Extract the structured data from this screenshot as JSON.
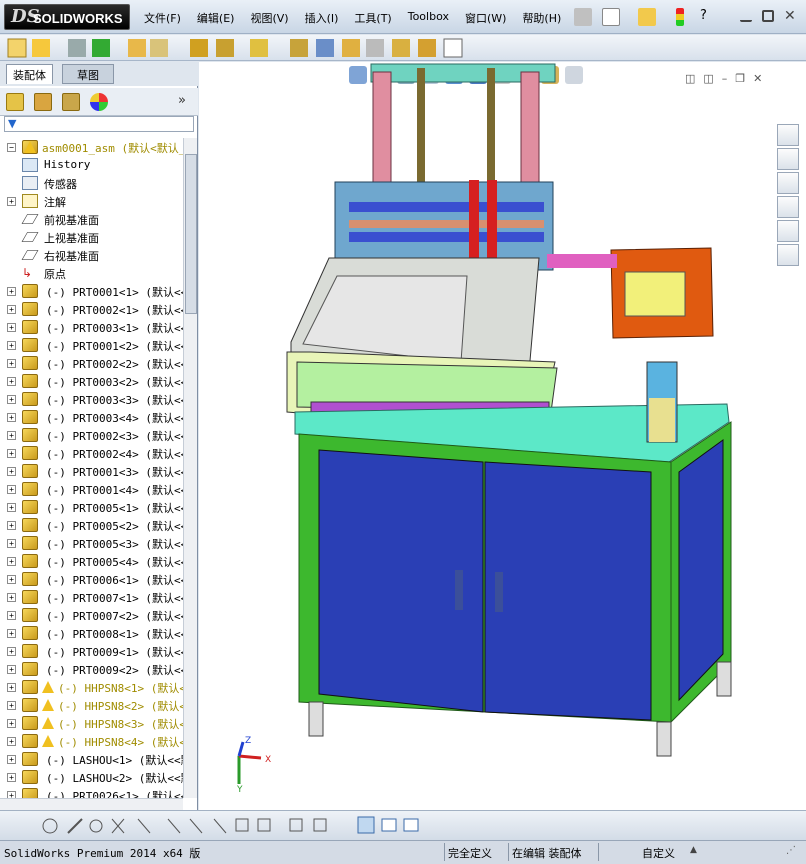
{
  "app": {
    "logo_prefix": "DS",
    "logo_name": "SOLIDWORKS"
  },
  "menu": [
    "文件(F)",
    "编辑(E)",
    "视图(V)",
    "插入(I)",
    "工具(T)",
    "Toolbox",
    "窗口(W)",
    "帮助(H)"
  ],
  "tabs": {
    "assembly": "装配体",
    "sketch": "草图"
  },
  "tree": [
    {
      "label": "asm0001_asm  (默认<默认_",
      "kind": "root"
    },
    {
      "label": "History",
      "kind": "history"
    },
    {
      "label": "传感器",
      "kind": "sensor"
    },
    {
      "label": "注解",
      "kind": "annotation"
    },
    {
      "label": "前视基准面",
      "kind": "plane"
    },
    {
      "label": "上视基准面",
      "kind": "plane"
    },
    {
      "label": "右视基准面",
      "kind": "plane"
    },
    {
      "label": "原点",
      "kind": "origin"
    },
    {
      "label": "(-) PRT0001<1> (默认<<默",
      "kind": "part"
    },
    {
      "label": "(-) PRT0002<1> (默认<<默",
      "kind": "part"
    },
    {
      "label": "(-) PRT0003<1> (默认<<默",
      "kind": "part"
    },
    {
      "label": "(-) PRT0001<2> (默认<<默",
      "kind": "part"
    },
    {
      "label": "(-) PRT0002<2> (默认<<默",
      "kind": "part"
    },
    {
      "label": "(-) PRT0003<2> (默认<<默",
      "kind": "part"
    },
    {
      "label": "(-) PRT0003<3> (默认<<默",
      "kind": "part"
    },
    {
      "label": "(-) PRT0003<4> (默认<<默",
      "kind": "part"
    },
    {
      "label": "(-) PRT0002<3> (默认<<默",
      "kind": "part"
    },
    {
      "label": "(-) PRT0002<4> (默认<<默",
      "kind": "part"
    },
    {
      "label": "(-) PRT0001<3> (默认<<默",
      "kind": "part"
    },
    {
      "label": "(-) PRT0001<4> (默认<<默",
      "kind": "part"
    },
    {
      "label": "(-) PRT0005<1> (默认<<默",
      "kind": "part"
    },
    {
      "label": "(-) PRT0005<2> (默认<<默",
      "kind": "part"
    },
    {
      "label": "(-) PRT0005<3> (默认<<默",
      "kind": "part"
    },
    {
      "label": "(-) PRT0005<4> (默认<<默",
      "kind": "part"
    },
    {
      "label": "(-) PRT0006<1> (默认<<默",
      "kind": "part"
    },
    {
      "label": "(-) PRT0007<1> (默认<<默",
      "kind": "part"
    },
    {
      "label": "(-) PRT0007<2> (默认<<默",
      "kind": "part"
    },
    {
      "label": "(-) PRT0008<1> (默认<<默",
      "kind": "part"
    },
    {
      "label": "(-) PRT0009<1> (默认<<默",
      "kind": "part"
    },
    {
      "label": "(-) PRT0009<2> (默认<<默",
      "kind": "part"
    },
    {
      "label": "(-) HHPSN8<1> (默认<",
      "kind": "warn"
    },
    {
      "label": "(-) HHPSN8<2> (默认<",
      "kind": "warn"
    },
    {
      "label": "(-) HHPSN8<3> (默认<",
      "kind": "warn"
    },
    {
      "label": "(-) HHPSN8<4> (默认<",
      "kind": "warn"
    },
    {
      "label": "(-) LASHOU<1> (默认<<默",
      "kind": "part"
    },
    {
      "label": "(-) LASHOU<2> (默认<<默",
      "kind": "part"
    },
    {
      "label": "(-) PRT0026<1> (默认<<默",
      "kind": "part"
    }
  ],
  "status": {
    "product": "SolidWorks Premium 2014 x64 版",
    "defined": "完全定义",
    "editing": "在编辑 装配体",
    "custom": "自定义"
  },
  "triad": {
    "x": "X",
    "y": "Y",
    "z": "Z"
  },
  "colors": {
    "frame": "#3db82e",
    "door": "#2a3fb5",
    "top": "#4fd9b8",
    "accent": "#e05a10"
  }
}
